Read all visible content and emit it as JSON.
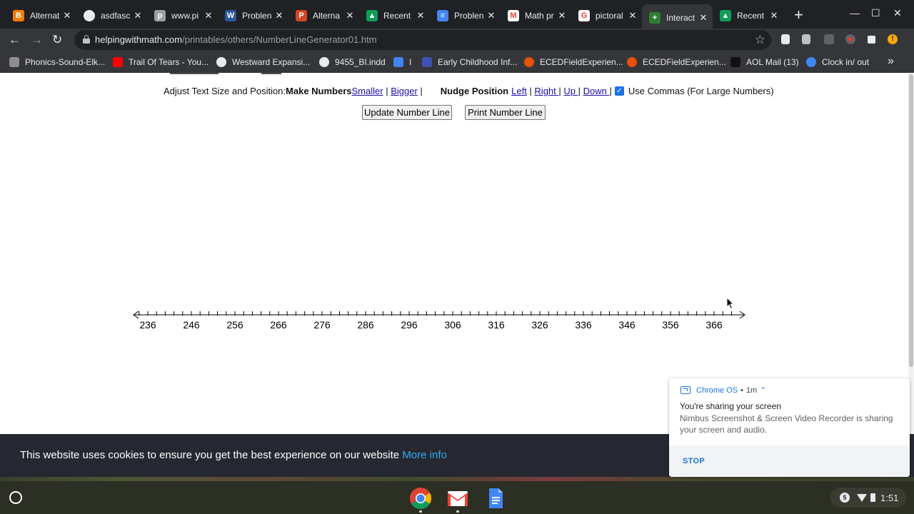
{
  "browser": {
    "tabs": [
      {
        "title": "Alternat",
        "icon": "blogger-icon",
        "color": "#f57c00",
        "glyph": "B"
      },
      {
        "title": "asdfasc",
        "icon": "globe-icon",
        "color": "#e8eaed",
        "glyph": ""
      },
      {
        "title": "www.pi",
        "icon": "pinterest-icon",
        "color": "#9aa0a6",
        "glyph": "p"
      },
      {
        "title": "Problen",
        "icon": "word-icon",
        "color": "#2b579a",
        "glyph": "W"
      },
      {
        "title": "Alterna",
        "icon": "powerpoint-icon",
        "color": "#d24726",
        "glyph": "P"
      },
      {
        "title": "Recent",
        "icon": "drive-icon",
        "color": "#0f9d58",
        "glyph": "▲"
      },
      {
        "title": "Problen",
        "icon": "docs-icon",
        "color": "#4285f4",
        "glyph": "≡"
      },
      {
        "title": "Math pr",
        "icon": "gmail-icon",
        "color": "#ffffff",
        "glyph": "M"
      },
      {
        "title": "pictoral",
        "icon": "google-icon",
        "color": "#ffffff",
        "glyph": "G"
      },
      {
        "title": "Interact",
        "icon": "helpingwithmath-icon",
        "color": "#2e7d32",
        "glyph": "+",
        "active": true
      },
      {
        "title": "Recent",
        "icon": "drive-icon",
        "color": "#0f9d58",
        "glyph": "▲"
      }
    ],
    "close_glyph": "✕",
    "new_tab_glyph": "+",
    "window_controls": {
      "minimize": "—",
      "maximize": "☐",
      "close": "✕"
    },
    "nav": {
      "back": "←",
      "forward": "→",
      "reload": "↻"
    },
    "url_domain": "helpingwithmath.com",
    "url_path": "/printables/others/NumberLineGenerator01.htm",
    "star_glyph": "☆",
    "bookmarks": [
      {
        "label": "Phonics-Sound-Elk...",
        "icon": "site-icon",
        "color": "#8e8e8e"
      },
      {
        "label": "Trail Of Tears - You...",
        "icon": "youtube-icon",
        "color": "#ff0000"
      },
      {
        "label": "Westward Expansi...",
        "icon": "globe-icon",
        "color": "#e8eaed"
      },
      {
        "label": "9455_BI.indd",
        "icon": "globe-icon",
        "color": "#e8eaed"
      },
      {
        "label": "I",
        "icon": "docs-icon",
        "color": "#4285f4"
      },
      {
        "label": "Early Childhood Inf...",
        "icon": "forms-icon",
        "color": "#3f51b5"
      },
      {
        "label": "ECEDFieldExperien...",
        "icon": "sparkle-icon",
        "color": "#e65100"
      },
      {
        "label": "ECEDFieldExperien...",
        "icon": "sparkle-icon",
        "color": "#e65100"
      },
      {
        "label": "AOL Mail (13)",
        "icon": "aol-icon",
        "color": "#111111"
      },
      {
        "label": "Clock in/ out",
        "icon": "clock-site-icon",
        "color": "#4285f4"
      }
    ],
    "bookmarks_overflow": "»"
  },
  "page": {
    "controls": {
      "intro": "Adjust Text Size and Position: ",
      "make_numbers": "Make Numbers",
      "smaller": " Smaller",
      "sep1": " | ",
      "bigger": "Bigger",
      "sep2": " |",
      "nudge": "Nudge Position",
      "left": "Left",
      "sep3": " | ",
      "right": "Right ",
      "sep4": "| ",
      "up": "Up ",
      "sep5": "| ",
      "down": "Down ",
      "sep6": "|",
      "checkbox_checked": true,
      "use_commas": "Use Commas (For Large Numbers)"
    },
    "update_button": "Update Number Line",
    "print_button": "Print Number Line",
    "number_line": {
      "start": 236,
      "end": 366,
      "label_step": 10,
      "tick_step": 1,
      "minor_ticks_per_label": 5,
      "labels": [
        "236",
        "246",
        "256",
        "266",
        "276",
        "286",
        "296",
        "306",
        "316",
        "326",
        "336",
        "346",
        "356",
        "366"
      ]
    }
  },
  "cookie": {
    "text": "This website uses cookies to ensure you get the best experience on our website ",
    "link": "More info"
  },
  "notification": {
    "source": "Chrome OS",
    "dot": "•",
    "time": "1m",
    "chevron": "⌃",
    "title": "You're sharing your screen",
    "body": "Nimbus Screenshot & Screen Video Recorder is sharing your screen and audio.",
    "action": "STOP"
  },
  "shelf": {
    "apps": [
      "chrome-icon",
      "gmail-icon",
      "docs-icon"
    ],
    "notification_count": "5",
    "time": "1:51"
  }
}
